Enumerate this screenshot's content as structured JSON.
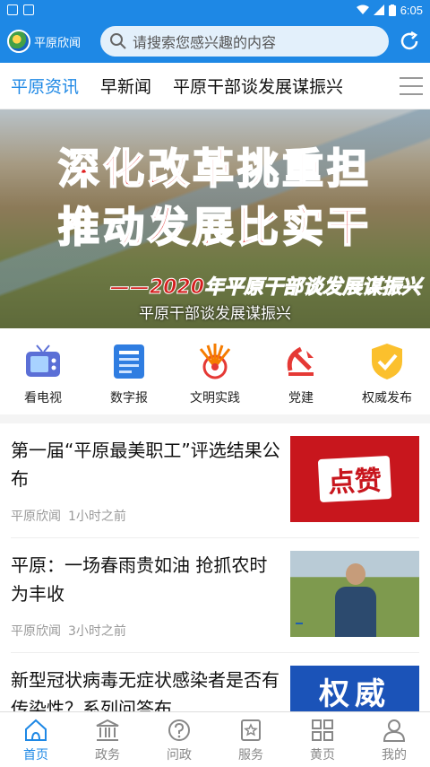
{
  "status_bar": {
    "time": "6:05"
  },
  "header": {
    "app_name": "平原欣闻",
    "search_placeholder": "请搜索您感兴趣的内容"
  },
  "tabs": [
    {
      "label": "平原资讯",
      "active": true
    },
    {
      "label": "早新闻",
      "active": false
    },
    {
      "label": "平原干部谈发展谋振兴",
      "active": false
    }
  ],
  "banner": {
    "line1": "深化改革挑重担",
    "line2": "推动发展比实干",
    "subline": "——2020年平原干部谈发展谋振兴",
    "caption": "平原干部谈发展谋振兴"
  },
  "quick_links": [
    {
      "label": "看电视",
      "icon": "tv-icon"
    },
    {
      "label": "数字报",
      "icon": "newspaper-icon"
    },
    {
      "label": "文明实践",
      "icon": "civilization-practice-icon"
    },
    {
      "label": "党建",
      "icon": "party-emblem-icon"
    },
    {
      "label": "权威发布",
      "icon": "shield-check-icon"
    }
  ],
  "news": [
    {
      "title": "第一届“平原最美职工”评选结果公布",
      "source": "平原欣闻",
      "time": "1小时之前",
      "thumb_text": "点赞"
    },
    {
      "title": "平原：一场春雨贵如油 抢抓农时为丰收",
      "source": "平原欣闻",
      "time": "3小时之前",
      "thumb_text": ""
    },
    {
      "title": "新型冠状病毒无症状感染者是否有传染性？系列问答布",
      "source": "",
      "time": "",
      "thumb_text": "权威"
    }
  ],
  "bottom_nav": [
    {
      "label": "首页",
      "icon": "home-icon",
      "active": true
    },
    {
      "label": "政务",
      "icon": "government-icon",
      "active": false
    },
    {
      "label": "问政",
      "icon": "question-icon",
      "active": false
    },
    {
      "label": "服务",
      "icon": "service-star-icon",
      "active": false
    },
    {
      "label": "黄页",
      "icon": "grid-icon",
      "active": false
    },
    {
      "label": "我的",
      "icon": "user-icon",
      "active": false
    }
  ],
  "colors": {
    "primary": "#1e88e5",
    "banner_red": "#e02020"
  }
}
